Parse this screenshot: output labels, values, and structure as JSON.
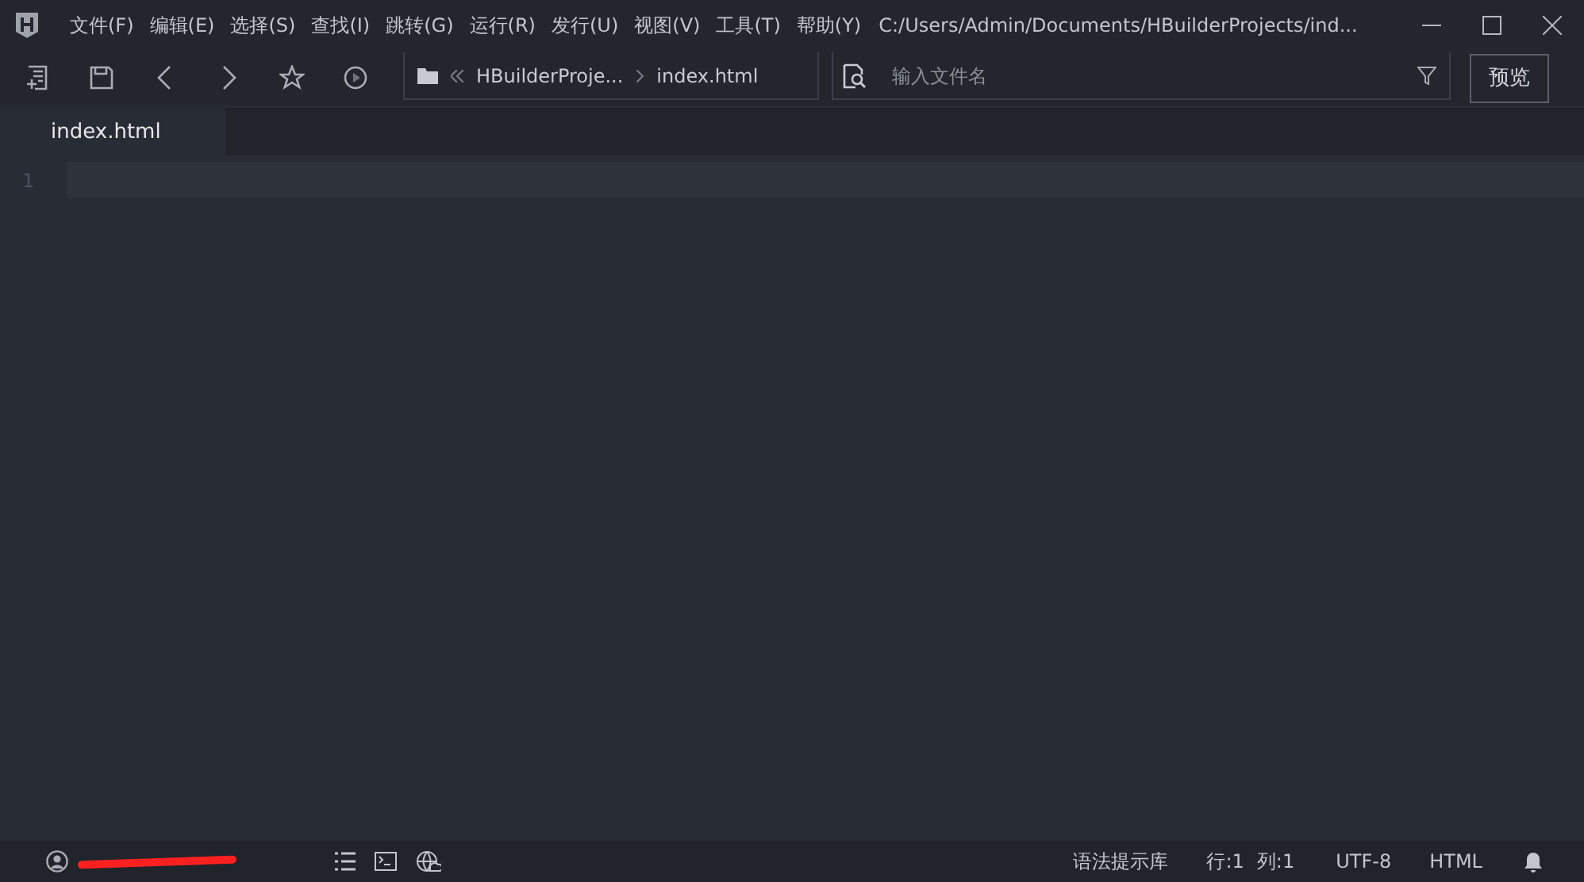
{
  "window": {
    "title": "C:/Users/Admin/Documents/HBuilderProjects/ind..."
  },
  "menu": [
    "文件(F)",
    "编辑(E)",
    "选择(S)",
    "查找(I)",
    "跳转(G)",
    "运行(R)",
    "发行(U)",
    "视图(V)",
    "工具(T)",
    "帮助(Y)"
  ],
  "toolbar": {
    "breadcrumb": [
      "HBuilderProje...",
      "index.html"
    ],
    "search": {
      "placeholder": "输入文件名"
    },
    "preview_button": "预览"
  },
  "tabs": [
    {
      "label": "index.html",
      "selected": true
    }
  ],
  "editor": {
    "line_numbers": [
      "1"
    ]
  },
  "status_bar": {
    "items": [
      "语法提示库",
      "行:1",
      "列:1",
      "UTF-8",
      "HTML"
    ]
  }
}
